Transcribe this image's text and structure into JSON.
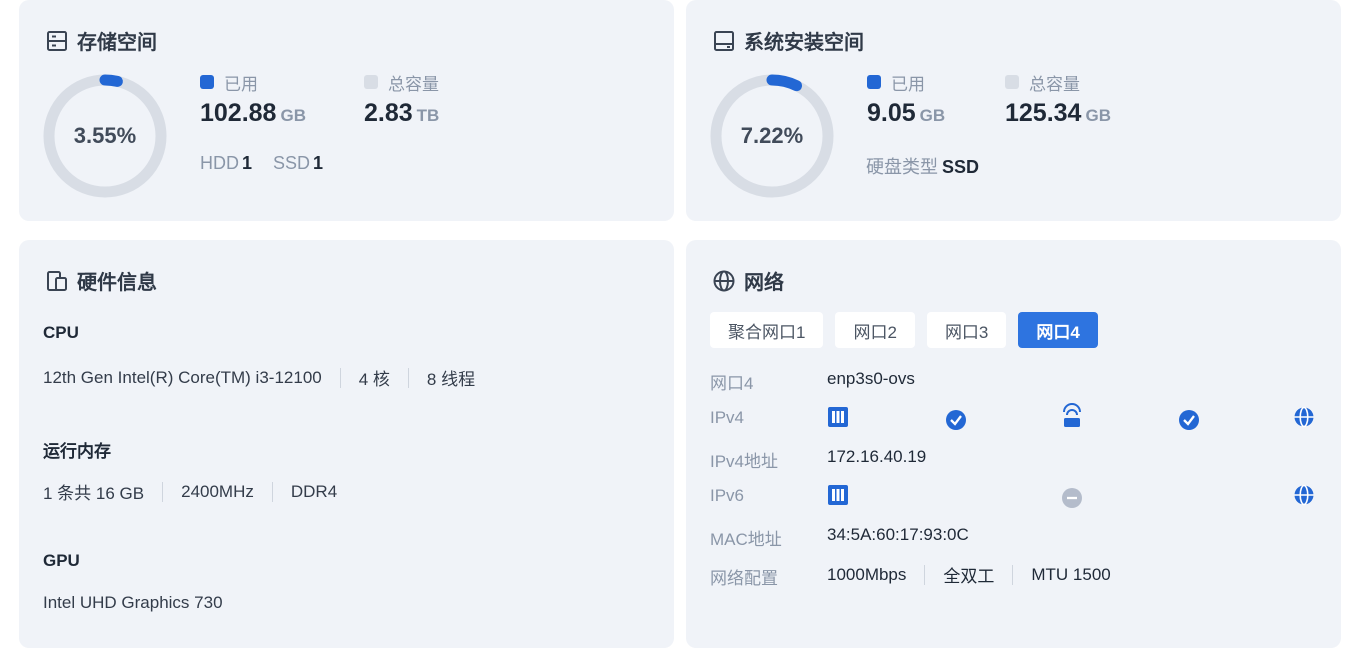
{
  "storage": {
    "title": "存储空间",
    "percent_text": "3.55%",
    "percent": 3.55,
    "used_label": "已用",
    "used_value": "102.88",
    "used_unit": "GB",
    "total_label": "总容量",
    "total_value": "2.83",
    "total_unit": "TB",
    "hdd_label": "HDD",
    "hdd_count": "1",
    "ssd_label": "SSD",
    "ssd_count": "1"
  },
  "system": {
    "title": "系统安装空间",
    "percent_text": "7.22%",
    "percent": 7.22,
    "used_label": "已用",
    "used_value": "9.05",
    "used_unit": "GB",
    "total_label": "总容量",
    "total_value": "125.34",
    "total_unit": "GB",
    "disk_type_label": "硬盘类型",
    "disk_type_value": "SSD"
  },
  "hardware": {
    "title": "硬件信息",
    "cpu_heading": "CPU",
    "cpu_model": "12th Gen Intel(R) Core(TM) i3-12100",
    "cpu_cores": "4 核",
    "cpu_threads": "8 线程",
    "memory_heading": "运行内存",
    "memory_count": "1 条共 16 GB",
    "memory_speed": "2400MHz",
    "memory_type": "DDR4",
    "gpu_heading": "GPU",
    "gpu_model": "Intel UHD Graphics 730"
  },
  "network": {
    "title": "网络",
    "tabs": [
      "聚合网口1",
      "网口2",
      "网口3",
      "网口4"
    ],
    "active_tab": "网口4",
    "rows": {
      "port_label": "网口4",
      "port_value": "enp3s0-ovs",
      "ipv4_label": "IPv4",
      "ipv4_addr_label": "IPv4地址",
      "ipv4_addr_value": "172.16.40.19",
      "ipv6_label": "IPv6",
      "mac_label": "MAC地址",
      "mac_value": "34:5A:60:17:93:0C",
      "config_label": "网络配置",
      "config_speed": "1000Mbps",
      "config_duplex": "全双工",
      "config_mtu": "MTU 1500"
    },
    "ipv4_status": [
      "connected",
      "connected"
    ],
    "ipv6_status": [
      "disconnected"
    ]
  },
  "colors": {
    "accent": "#2367d4",
    "card_bg": "#f0f3f8",
    "ring_bg": "#d8dde5",
    "muted": "#8a96a8",
    "disconnected": "#b4bccb"
  }
}
